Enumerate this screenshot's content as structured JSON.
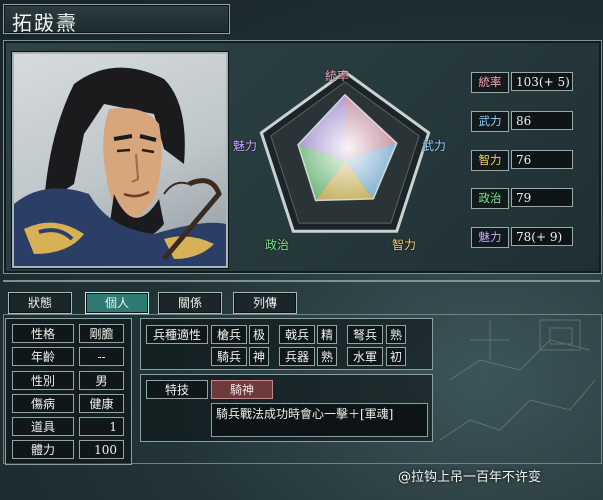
{
  "character": {
    "name": "拓跋燾"
  },
  "radar": {
    "labels": {
      "top": "統率",
      "right": "武力",
      "bottom_right": "智力",
      "bottom_left": "政治",
      "left": "魅力"
    },
    "values": {
      "tongshuai": 103,
      "wuli": 86,
      "zhili": 76,
      "zhengzhi": 79,
      "meili": 78
    },
    "max": 120
  },
  "stats": [
    {
      "key": "統率",
      "value": "103(+ 5)",
      "color": "#f2a3b6"
    },
    {
      "key": "武力",
      "value": "86",
      "color": "#8fd0ff"
    },
    {
      "key": "智力",
      "value": "76",
      "color": "#f4d35e"
    },
    {
      "key": "政治",
      "value": "79",
      "color": "#7fe08a"
    },
    {
      "key": "魅力",
      "value": "78(+ 9)",
      "color": "#c4a6ff"
    }
  ],
  "tabs": [
    "狀態",
    "個人",
    "關係",
    "列傳"
  ],
  "active_tab": "個人",
  "personal": [
    {
      "label": "性格",
      "value": "剛膽"
    },
    {
      "label": "年齡",
      "value": "--"
    },
    {
      "label": "性別",
      "value": "男"
    },
    {
      "label": "傷病",
      "value": "健康"
    },
    {
      "label": "道具",
      "value": "1"
    },
    {
      "label": "體力",
      "value": "100"
    }
  ],
  "aptitude": {
    "title": "兵種適性",
    "rows": [
      [
        {
          "unit": "槍兵",
          "grade": "极"
        },
        {
          "unit": "戟兵",
          "grade": "精"
        },
        {
          "unit": "弩兵",
          "grade": "熟"
        }
      ],
      [
        {
          "unit": "騎兵",
          "grade": "神"
        },
        {
          "unit": "兵器",
          "grade": "熟"
        },
        {
          "unit": "水軍",
          "grade": "初"
        }
      ]
    ]
  },
  "skill": {
    "label": "特技",
    "name": "騎神",
    "description": "騎兵戰法成功時會心一擊＋[軍魂]"
  },
  "watermark": "@拉钩上吊一百年不许变"
}
